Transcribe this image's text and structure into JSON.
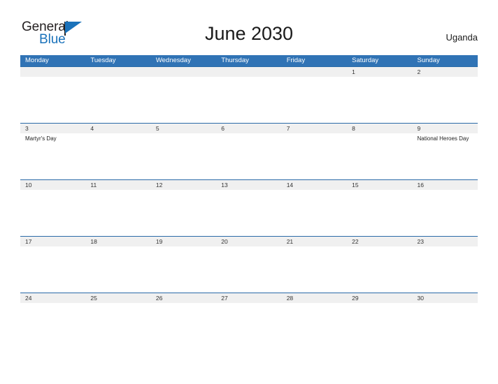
{
  "brand": {
    "name_part1": "General",
    "name_part2": "Blue",
    "flag_icon": "blue-flag-triangle",
    "accent_color": "#1a72ba"
  },
  "header": {
    "title": "June 2030",
    "country": "Uganda"
  },
  "colors": {
    "weekday_header_bg": "#3073b5",
    "date_band_bg": "#f0f0f0",
    "date_band_border": "#2a6aa8",
    "page_bg": "#ffffff",
    "text": "#1a1a1a"
  },
  "calendar": {
    "weekdays": [
      "Monday",
      "Tuesday",
      "Wednesday",
      "Thursday",
      "Friday",
      "Saturday",
      "Sunday"
    ],
    "weeks": [
      {
        "days": [
          {
            "num": "",
            "event": ""
          },
          {
            "num": "",
            "event": ""
          },
          {
            "num": "",
            "event": ""
          },
          {
            "num": "",
            "event": ""
          },
          {
            "num": "",
            "event": ""
          },
          {
            "num": "1",
            "event": ""
          },
          {
            "num": "2",
            "event": ""
          }
        ]
      },
      {
        "days": [
          {
            "num": "3",
            "event": "Martyr's Day"
          },
          {
            "num": "4",
            "event": ""
          },
          {
            "num": "5",
            "event": ""
          },
          {
            "num": "6",
            "event": ""
          },
          {
            "num": "7",
            "event": ""
          },
          {
            "num": "8",
            "event": ""
          },
          {
            "num": "9",
            "event": "National Heroes Day"
          }
        ]
      },
      {
        "days": [
          {
            "num": "10",
            "event": ""
          },
          {
            "num": "11",
            "event": ""
          },
          {
            "num": "12",
            "event": ""
          },
          {
            "num": "13",
            "event": ""
          },
          {
            "num": "14",
            "event": ""
          },
          {
            "num": "15",
            "event": ""
          },
          {
            "num": "16",
            "event": ""
          }
        ]
      },
      {
        "days": [
          {
            "num": "17",
            "event": ""
          },
          {
            "num": "18",
            "event": ""
          },
          {
            "num": "19",
            "event": ""
          },
          {
            "num": "20",
            "event": ""
          },
          {
            "num": "21",
            "event": ""
          },
          {
            "num": "22",
            "event": ""
          },
          {
            "num": "23",
            "event": ""
          }
        ]
      },
      {
        "days": [
          {
            "num": "24",
            "event": ""
          },
          {
            "num": "25",
            "event": ""
          },
          {
            "num": "26",
            "event": ""
          },
          {
            "num": "27",
            "event": ""
          },
          {
            "num": "28",
            "event": ""
          },
          {
            "num": "29",
            "event": ""
          },
          {
            "num": "30",
            "event": ""
          }
        ]
      }
    ]
  }
}
